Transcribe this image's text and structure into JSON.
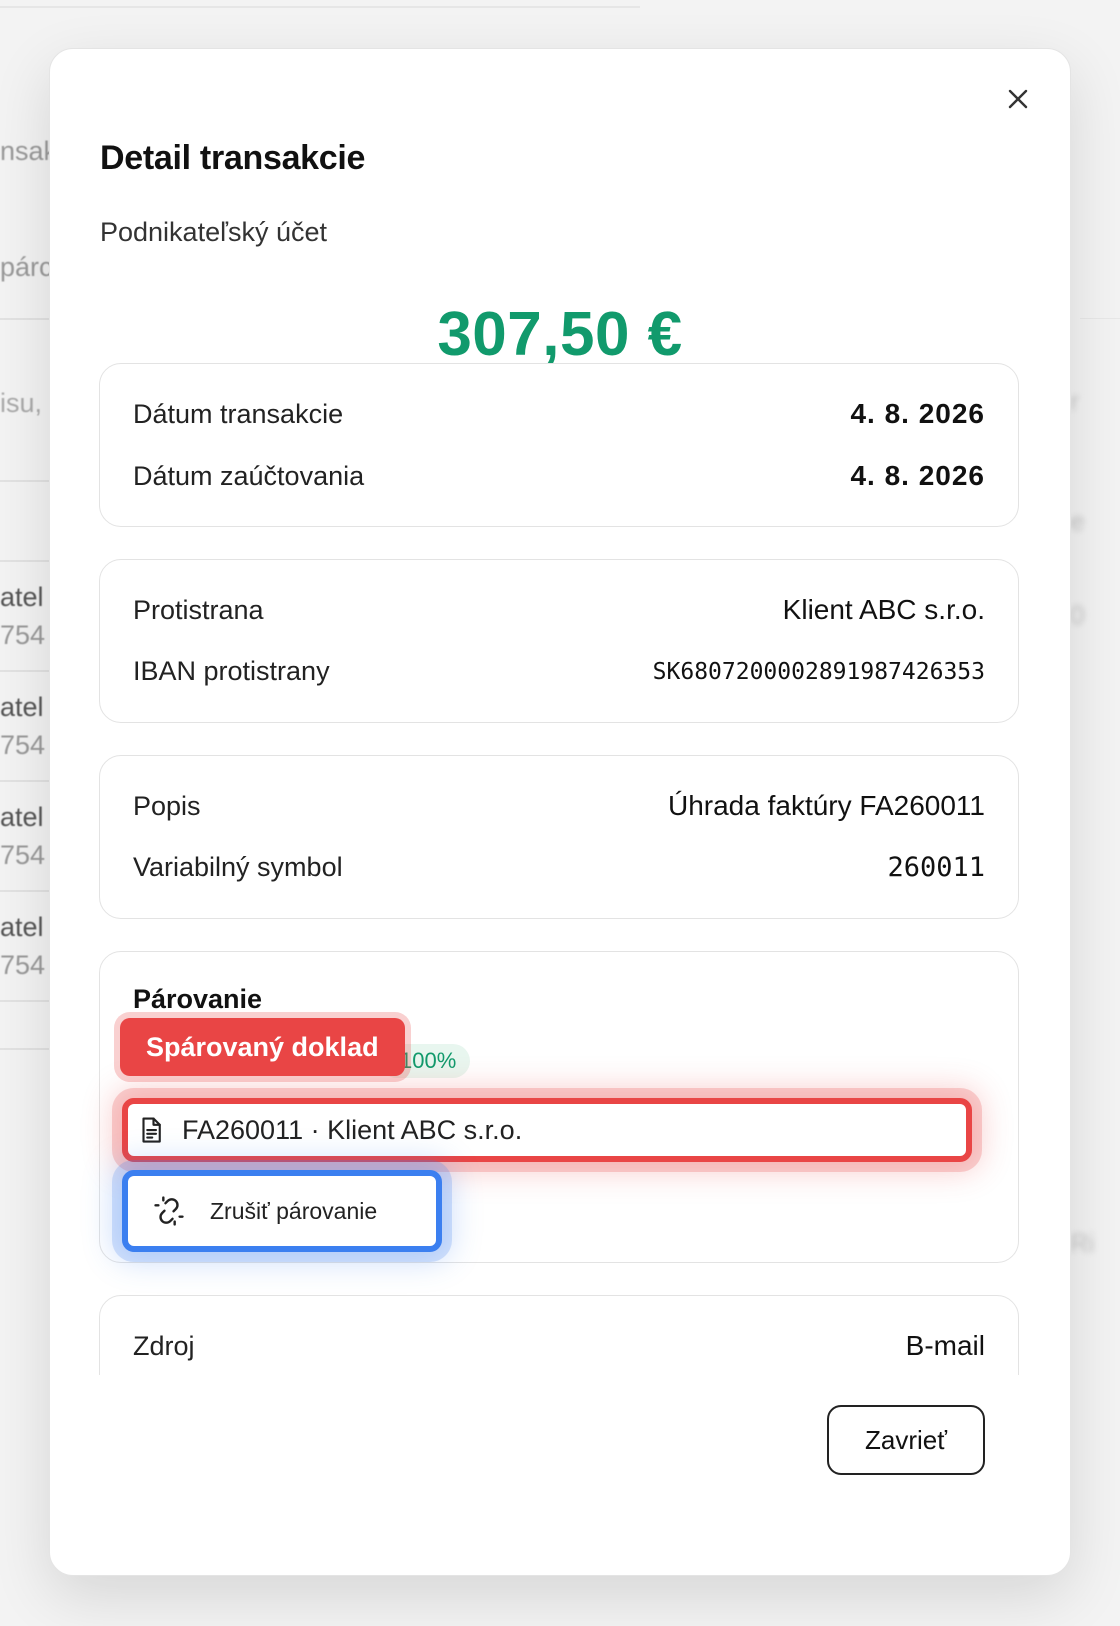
{
  "background": {
    "fragments": [
      "nsak",
      "párc",
      "isu,",
      "atel",
      "754",
      "atel",
      "754",
      "atel",
      "754",
      "atel",
      "754"
    ],
    "right_fragments": [
      "r",
      "e",
      "0",
      "Ri"
    ]
  },
  "modal": {
    "title": "Detail transakcie",
    "account": "Podnikateľský účet",
    "amount": "307,50 €",
    "amount_color": "#119a6c",
    "dates": {
      "transaction_label": "Dátum transakcie",
      "transaction_value": "4. 8. 2026",
      "posting_label": "Dátum zaúčtovania",
      "posting_value": "4. 8. 2026"
    },
    "counterparty": {
      "name_label": "Protistrana",
      "name_value": "Klient ABC s.r.o.",
      "iban_label": "IBAN protistrany",
      "iban_value": "SK6807200002891987426353"
    },
    "details": {
      "description_label": "Popis",
      "description_value": "Úhrada faktúry FA260011",
      "vs_label": "Variabilný symbol",
      "vs_value": "260011"
    },
    "matching": {
      "title": "Párovanie",
      "tag": "Spárovaný doklad",
      "score": "100%",
      "document": "FA260011 · Klient ABC s.r.o.",
      "unmatch_label": "Zrušiť párovanie",
      "highlight_red": "#e94545",
      "highlight_blue": "#3b7ff0"
    },
    "source": {
      "label": "Zdroj",
      "value": "B-mail"
    },
    "close_label": "Zavrieť"
  }
}
